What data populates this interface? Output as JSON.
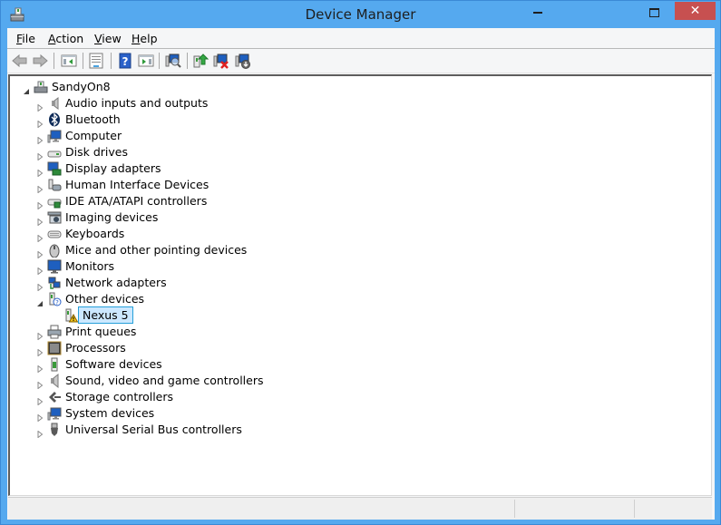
{
  "window": {
    "title": "Device Manager",
    "controls": {
      "minimize": "minimize",
      "maximize": "maximize",
      "close": "✕"
    }
  },
  "menu": {
    "items": [
      {
        "label": "File",
        "accel": "F"
      },
      {
        "label": "Action",
        "accel": "A"
      },
      {
        "label": "View",
        "accel": "V"
      },
      {
        "label": "Help",
        "accel": "H"
      }
    ]
  },
  "toolbar": {
    "buttons": [
      "back-icon",
      "forward-icon",
      "show-hide-console-tree-icon",
      "properties-icon",
      "help-icon",
      "show-action-pane-icon",
      "scan-hardware-icon",
      "update-driver-icon",
      "uninstall-device-icon",
      "disable-device-icon"
    ]
  },
  "tree": {
    "root": {
      "label": "SandyOn8",
      "expanded": true,
      "icon": "computer-root-icon"
    },
    "categories": [
      {
        "label": "Audio inputs and outputs",
        "icon": "speaker-icon",
        "expanded": false
      },
      {
        "label": "Bluetooth",
        "icon": "bluetooth-icon",
        "expanded": false
      },
      {
        "label": "Computer",
        "icon": "computer-icon",
        "expanded": false
      },
      {
        "label": "Disk drives",
        "icon": "disk-drive-icon",
        "expanded": false
      },
      {
        "label": "Display adapters",
        "icon": "display-adapter-icon",
        "expanded": false
      },
      {
        "label": "Human Interface Devices",
        "icon": "hid-icon",
        "expanded": false
      },
      {
        "label": "IDE ATA/ATAPI controllers",
        "icon": "ide-controller-icon",
        "expanded": false
      },
      {
        "label": "Imaging devices",
        "icon": "camera-icon",
        "expanded": false
      },
      {
        "label": "Keyboards",
        "icon": "keyboard-icon",
        "expanded": false
      },
      {
        "label": "Mice and other pointing devices",
        "icon": "mouse-icon",
        "expanded": false
      },
      {
        "label": "Monitors",
        "icon": "monitor-icon",
        "expanded": false
      },
      {
        "label": "Network adapters",
        "icon": "network-adapter-icon",
        "expanded": false
      },
      {
        "label": "Other devices",
        "icon": "unknown-device-icon",
        "expanded": true,
        "children": [
          {
            "label": "Nexus 5",
            "icon": "warning-device-icon",
            "selected": true
          }
        ]
      },
      {
        "label": "Print queues",
        "icon": "printer-icon",
        "expanded": false
      },
      {
        "label": "Processors",
        "icon": "processor-icon",
        "expanded": false
      },
      {
        "label": "Software devices",
        "icon": "software-device-icon",
        "expanded": false
      },
      {
        "label": "Sound, video and game controllers",
        "icon": "sound-icon",
        "expanded": false
      },
      {
        "label": "Storage controllers",
        "icon": "storage-controller-icon",
        "expanded": false
      },
      {
        "label": "System devices",
        "icon": "system-devices-icon",
        "expanded": false
      },
      {
        "label": "Universal Serial Bus controllers",
        "icon": "usb-icon",
        "expanded": false
      }
    ]
  },
  "statusbar": {
    "panes": [
      "",
      "",
      ""
    ]
  },
  "colors": {
    "titlebar": "#55a9ef",
    "close": "#c75050",
    "selection": "#cce8ff",
    "selection_border": "#26a0da"
  }
}
